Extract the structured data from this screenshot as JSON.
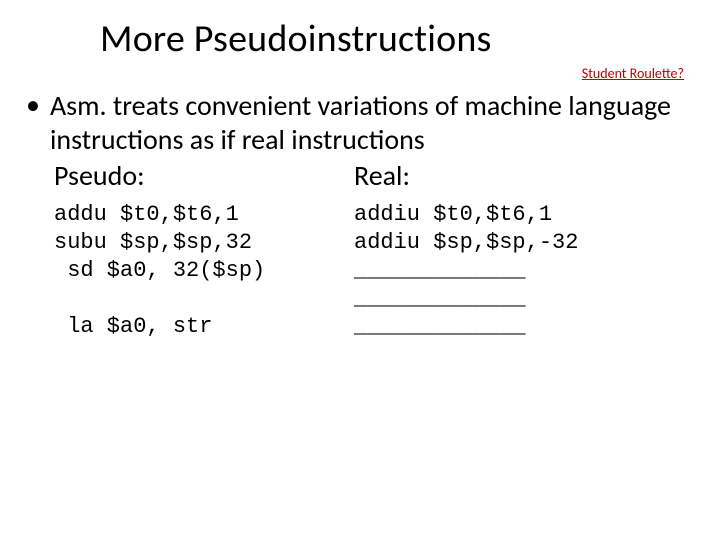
{
  "title": "More Pseudoinstructions",
  "link": "Student Roulette?",
  "bullet": "Asm. treats convenient variations of machine language instructions as if real instructions",
  "labels": {
    "pseudo": "Pseudo:",
    "real": "Real:"
  },
  "code": {
    "pseudo": "addu $t0,$t6,1\nsubu $sp,$sp,32\n sd $a0, 32($sp)\n\n la $a0, str",
    "real": "addiu $t0,$t6,1\naddiu $sp,$sp,-32\n_____________\n_____________\n_____________"
  }
}
